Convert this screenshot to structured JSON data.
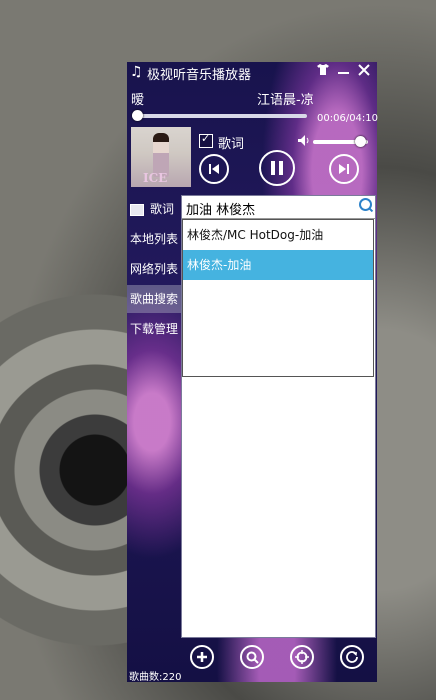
{
  "window": {
    "title": "极视听音乐播放器",
    "buttons": {
      "skin": "👕",
      "minimize": "—",
      "close": "✕"
    }
  },
  "now_playing": {
    "song_left": "暧",
    "song_right": "江语晨-凉",
    "time": "00:06/04:10",
    "progress_fraction": 0.03,
    "lyrics_label": "歌词",
    "lyrics_checked": true,
    "cover_text": "ICE"
  },
  "volume": {
    "level_fraction": 0.85
  },
  "sidebar": {
    "items": [
      {
        "label": "歌词",
        "icon": "lyrics-icon"
      },
      {
        "label": "本地列表"
      },
      {
        "label": "网络列表"
      },
      {
        "label": "歌曲搜索"
      },
      {
        "label": "下载管理"
      }
    ],
    "active_index": 3
  },
  "search": {
    "query": "加油 林俊杰",
    "results": [
      "林俊杰/MC HotDog-加油",
      "林俊杰-加油"
    ],
    "selected_index": 1
  },
  "footer": {
    "count_label": "歌曲数:220"
  }
}
